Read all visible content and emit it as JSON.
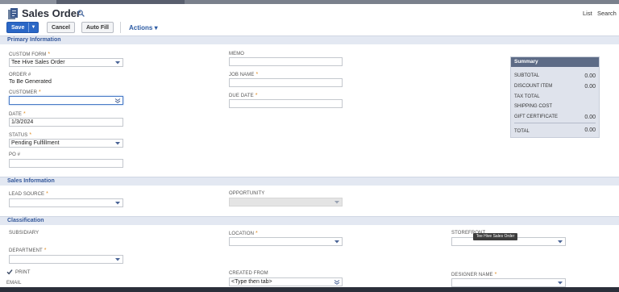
{
  "header": {
    "title": "Sales Order",
    "nav_list": "List",
    "nav_search": "Search"
  },
  "toolbar": {
    "save_label": "Save",
    "cancel_label": "Cancel",
    "autofill_label": "Auto Fill",
    "actions_label": "Actions",
    "actions_caret": "▾",
    "save_caret": "▼"
  },
  "sections": {
    "primary": "Primary Information",
    "sales": "Sales Information",
    "classification": "Classification"
  },
  "primary": {
    "custom_form_label": "CUSTOM FORM",
    "custom_form_value": "Tee Hive Sales Order",
    "order_label": "ORDER #",
    "order_value": "To Be Generated",
    "customer_label": "CUSTOMER",
    "customer_value": "",
    "date_label": "DATE",
    "date_value": "1/3/2024",
    "status_label": "STATUS",
    "status_value": "Pending Fulfillment",
    "po_label": "PO #",
    "po_value": "",
    "memo_label": "MEMO",
    "memo_value": "",
    "job_name_label": "JOB NAME",
    "job_name_value": "",
    "due_date_label": "DUE DATE",
    "due_date_value": "",
    "required_mark": "*"
  },
  "summary": {
    "title": "Summary",
    "subtotal_label": "SUBTOTAL",
    "subtotal_value": "0.00",
    "discount_label": "DISCOUNT ITEM",
    "discount_value": "0.00",
    "tax_label": "TAX TOTAL",
    "shipping_label": "SHIPPING COST",
    "gift_label": "GIFT CERTIFICATE",
    "gift_value": "0.00",
    "total_label": "TOTAL",
    "total_value": "0.00"
  },
  "sales": {
    "lead_source_label": "LEAD SOURCE",
    "opportunity_label": "OPPORTUNITY"
  },
  "classification": {
    "subsidiary_label": "SUBSIDIARY",
    "location_label": "LOCATION",
    "storefront_label": "STOREFRONT",
    "department_label": "DEPARTMENT",
    "print_label": "PRINT",
    "email_label": "EMAIL",
    "created_from_label": "CREATED FROM",
    "created_from_value": "<Type then tab>",
    "designer_label": "DESIGNER NAME",
    "tooltip": "Tee Hive Sales Order"
  },
  "colors": {
    "accent": "#2b67c6",
    "section_bg": "#e3e8f2",
    "section_text": "#33579a",
    "required": "#e08a1e",
    "summary_header": "#5d6b86"
  },
  "icons": {
    "title": "sales-order-document-icon",
    "search": "search-icon",
    "dropdown": "chevron-down-icon",
    "double_dropdown": "double-chevron-icon",
    "check": "check-icon"
  }
}
